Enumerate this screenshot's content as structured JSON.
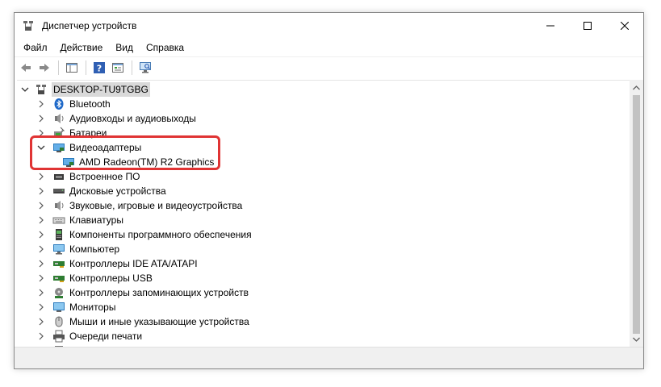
{
  "window": {
    "title": "Диспетчер устройств"
  },
  "menu": [
    "Файл",
    "Действие",
    "Вид",
    "Справка"
  ],
  "tree": {
    "root": "DESKTOP-TU9TGBG",
    "items": [
      {
        "label": "Bluetooth",
        "icon": "bluetooth-icon",
        "expanded": false
      },
      {
        "label": "Аудиовходы и аудиовыходы",
        "icon": "speaker-icon",
        "expanded": false
      },
      {
        "label": "Батареи",
        "icon": "battery-icon",
        "expanded": false
      },
      {
        "label": "Видеоадаптеры",
        "icon": "display-adapter-icon",
        "expanded": true,
        "children": [
          {
            "label": "AMD Radeon(TM) R2 Graphics",
            "icon": "display-adapter-icon"
          }
        ]
      },
      {
        "label": "Встроенное ПО",
        "icon": "firmware-icon",
        "expanded": false
      },
      {
        "label": "Дисковые устройства",
        "icon": "disk-icon",
        "expanded": false
      },
      {
        "label": "Звуковые, игровые и видеоустройства",
        "icon": "sound-icon",
        "expanded": false
      },
      {
        "label": "Клавиатуры",
        "icon": "keyboard-icon",
        "expanded": false
      },
      {
        "label": "Компоненты программного обеспечения",
        "icon": "software-component-icon",
        "expanded": false
      },
      {
        "label": "Компьютер",
        "icon": "computer-icon",
        "expanded": false
      },
      {
        "label": "Контроллеры IDE ATA/ATAPI",
        "icon": "ide-controller-icon",
        "expanded": false
      },
      {
        "label": "Контроллеры USB",
        "icon": "usb-icon",
        "expanded": false
      },
      {
        "label": "Контроллеры запоминающих устройств",
        "icon": "storage-controller-icon",
        "expanded": false
      },
      {
        "label": "Мониторы",
        "icon": "monitor-icon",
        "expanded": false
      },
      {
        "label": "Мыши и иные указывающие устройства",
        "icon": "mouse-icon",
        "expanded": false
      },
      {
        "label": "Очереди печати",
        "icon": "printer-icon",
        "expanded": false
      }
    ]
  },
  "highlight_color": "#e03434"
}
